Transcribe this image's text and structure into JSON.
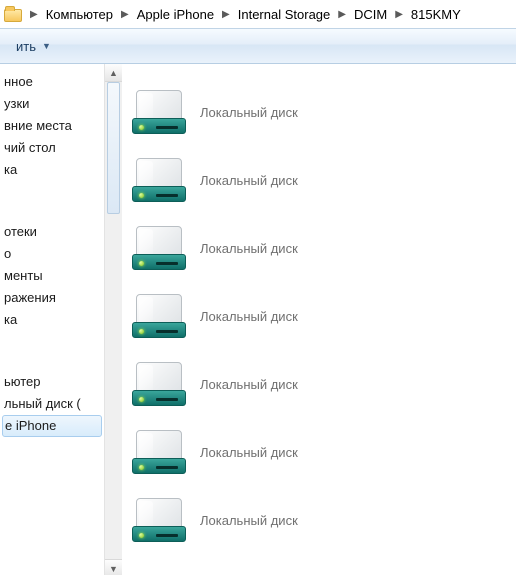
{
  "breadcrumb": {
    "items": [
      {
        "label": "Компьютер"
      },
      {
        "label": "Apple iPhone"
      },
      {
        "label": "Internal Storage"
      },
      {
        "label": "DCIM"
      },
      {
        "label": "815KMY"
      }
    ]
  },
  "toolbar": {
    "organize_label": "ить"
  },
  "sidebar": {
    "groups": [
      {
        "items": [
          {
            "label": "нное"
          },
          {
            "label": "узки"
          },
          {
            "label": "вние места"
          },
          {
            "label": "чий стол"
          },
          {
            "label": "ка"
          }
        ]
      },
      {
        "items": [
          {
            "label": "отеки"
          },
          {
            "label": "о"
          },
          {
            "label": "менты"
          },
          {
            "label": "ражения"
          },
          {
            "label": "ка"
          }
        ]
      },
      {
        "items": [
          {
            "label": "ьютер"
          },
          {
            "label": "льный диск ("
          },
          {
            "label": "e iPhone",
            "selected": true
          }
        ]
      }
    ]
  },
  "content": {
    "items": [
      {
        "label": "Локальный диск"
      },
      {
        "label": "Локальный диск"
      },
      {
        "label": "Локальный диск"
      },
      {
        "label": "Локальный диск"
      },
      {
        "label": "Локальный диск"
      },
      {
        "label": "Локальный диск"
      },
      {
        "label": "Локальный диск"
      }
    ]
  }
}
